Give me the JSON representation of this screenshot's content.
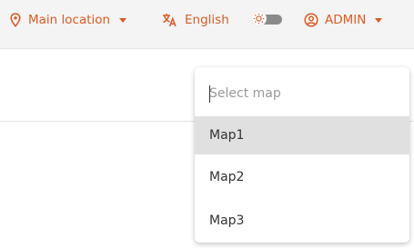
{
  "topbar": {
    "location": {
      "label": "Main location",
      "icon": "map-pin-icon"
    },
    "language": {
      "label": "English",
      "icon": "translate-icon"
    },
    "theme_toggle": {
      "icon": "sun-icon",
      "state": "off"
    },
    "user": {
      "label": "ADMIN",
      "icon": "user-circle-icon"
    }
  },
  "map_select": {
    "placeholder": "Select map",
    "options": [
      {
        "label": "Map1",
        "highlighted": true
      },
      {
        "label": "Map2",
        "highlighted": false
      },
      {
        "label": "Map3",
        "highlighted": false
      }
    ]
  },
  "colors": {
    "accent": "#e05a24",
    "topbar_bg": "#f4f4f4",
    "highlight_bg": "#e0e0e0",
    "text": "#333333"
  }
}
